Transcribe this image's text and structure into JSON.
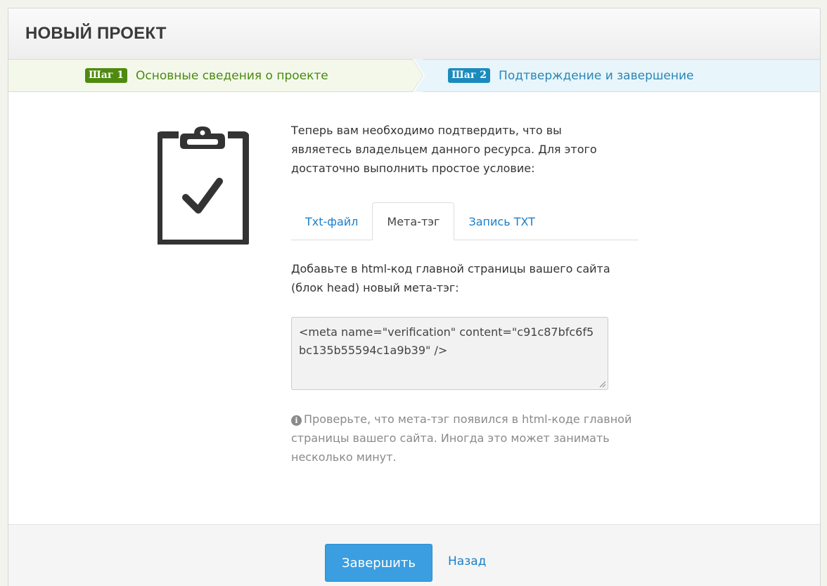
{
  "panel": {
    "title": "НОВЫЙ ПРОЕКТ"
  },
  "steps": [
    {
      "badge": "Шаг 1",
      "label": "Основные сведения о проекте",
      "state": "completed",
      "color": "#4f8a10"
    },
    {
      "badge": "Шаг 2",
      "label": "Подтверждение и завершение",
      "state": "current",
      "color": "#1b8bbd"
    }
  ],
  "illustration": {
    "icon": "clipboard-check-icon"
  },
  "intro_text": "Теперь вам необходимо подтвердить, что вы являетесь владельцем данного ресурса. Для этого достаточно выполнить простое условие:",
  "tabs": [
    {
      "label": "Txt-файл",
      "active": false
    },
    {
      "label": "Мета-тэг",
      "active": true
    },
    {
      "label": "Запись TXT",
      "active": false
    }
  ],
  "meta_tab": {
    "instruction": "Добавьте в html-код главной страницы вашего сайта (блок head) новый мета-тэг:",
    "code": "<meta name=\"verification\" content=\"c91c87bfc6f5bc135b55594c1a9b39\" />",
    "hint_icon": "info-circle-icon",
    "hint": "Проверьте, что мета-тэг появился в html-коде главной страницы вашего сайта. Иногда это может занимать несколько минут."
  },
  "footer": {
    "finish_label": "Завершить",
    "back_label": "Назад"
  },
  "colors": {
    "accent_blue": "#3a9ee0",
    "link_blue": "#1a7fc9",
    "step1_green": "#4f8a10",
    "step2_blue": "#1b8bbd"
  }
}
